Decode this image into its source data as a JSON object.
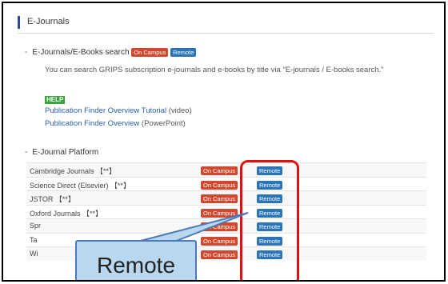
{
  "header": {
    "title": "E-Journals"
  },
  "search_section": {
    "title": "E-Journals/E-Books search",
    "badge_oncampus": "On Campus",
    "badge_remote": "Remote",
    "description": "You can search GRIPS subscription e-journals and e-books by title via \"E-journals / E-books search.\"",
    "help_label": "HELP",
    "links": [
      {
        "text": "Publication Finder Overview Tutorial",
        "suffix": " (video)"
      },
      {
        "text": "Publication Finder Overview",
        "suffix": " (PowerPoint)"
      }
    ]
  },
  "platform_section": {
    "title": "E-Journal Platform",
    "rows": [
      {
        "name": "Cambridge Journals 【**】",
        "oncampus": "On Campus",
        "remote": "Remote"
      },
      {
        "name": "Science Direct (Elsevier) 【**】",
        "oncampus": "On Campus",
        "remote": "Remote"
      },
      {
        "name": "JSTOR 【**】",
        "oncampus": "On Campus",
        "remote": "Remote"
      },
      {
        "name": "Oxford Journals 【**】",
        "oncampus": "On Campus",
        "remote": "Remote"
      },
      {
        "name": "Spr",
        "oncampus": "On Campus",
        "remote": "Remote"
      },
      {
        "name": "Ta",
        "oncampus": "On Campus",
        "remote": "Remote"
      },
      {
        "name": "Wi",
        "oncampus": "On Campus",
        "remote": "Remote"
      }
    ]
  },
  "callout": {
    "text": "Remote"
  },
  "colors": {
    "oncampus": "#d1482e",
    "remote": "#2a74b8",
    "highlight": "#e01010",
    "callout_fill": "#b9d7ee"
  }
}
